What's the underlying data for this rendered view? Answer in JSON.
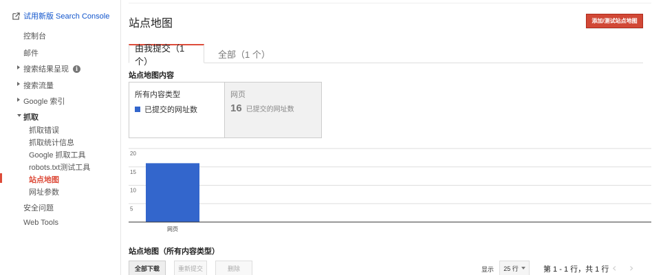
{
  "sidebar": {
    "try_new": "试用新版 Search Console",
    "items": [
      {
        "label": "控制台"
      },
      {
        "label": "邮件"
      },
      {
        "label": "搜索结果呈现"
      },
      {
        "label": "搜索流量"
      },
      {
        "label": "Google 索引"
      },
      {
        "label": "抓取"
      },
      {
        "label": "安全问题"
      },
      {
        "label": "Web Tools"
      }
    ],
    "crawl_sub": [
      {
        "label": "抓取错误"
      },
      {
        "label": "抓取统计信息"
      },
      {
        "label": "Google 抓取工具"
      },
      {
        "label": "robots.txt测试工具"
      },
      {
        "label": "站点地图"
      },
      {
        "label": "网址参数"
      }
    ]
  },
  "header": {
    "title": "站点地图",
    "add_button": "添加/测试站点地图"
  },
  "tabs": [
    {
      "label": "由我提交（1 个）"
    },
    {
      "label": "全部（1 个）"
    }
  ],
  "content": {
    "section_label": "站点地图内容",
    "card_all": {
      "title": "所有内容类型",
      "legend": "已提交的网址数"
    },
    "card_web": {
      "title": "网页",
      "count": "16",
      "count_label": "已提交的网址数"
    }
  },
  "chart_data": {
    "type": "bar",
    "categories": [
      "网页"
    ],
    "series": [
      {
        "name": "已提交的网址数",
        "values": [
          16
        ]
      }
    ],
    "ylim": [
      0,
      20
    ],
    "yticks": [
      5,
      10,
      15,
      20
    ],
    "grid": true,
    "color": "#3366cc"
  },
  "table": {
    "title": "站点地图（所有内容类型）",
    "download_all": "全部下载",
    "resubmit": "重新提交",
    "delete": "删除",
    "show_label": "显示",
    "rows_value": "25 行",
    "page_range": "第 1 - 1 行，共 1 行"
  },
  "colors": {
    "accent": "#dd4b39",
    "bar": "#3366cc",
    "link": "#1155cc"
  }
}
